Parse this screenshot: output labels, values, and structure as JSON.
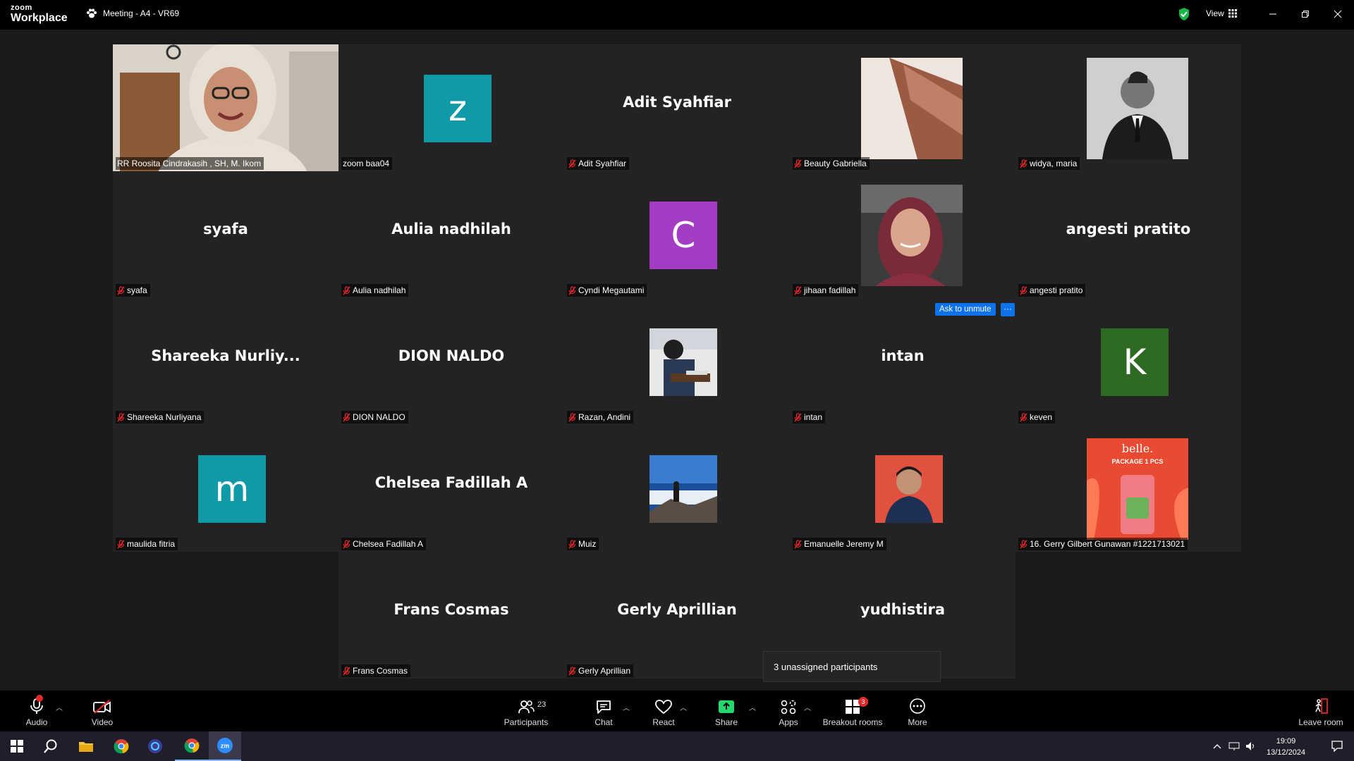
{
  "titlebar": {
    "logo_top": "zoom",
    "logo_bottom": "Workplace",
    "meeting_title": "Meeting - A4 - VR69",
    "view_label": "View",
    "icons": [
      "shield-check-icon",
      "grid-icon",
      "minimize-icon",
      "maximize-icon",
      "close-icon"
    ]
  },
  "ask_to_unmute": {
    "label": "Ask to unmute",
    "more": "···"
  },
  "unassigned": {
    "text": "3 unassigned participants"
  },
  "participants": [
    {
      "name": "RR Roosita Cindrakasih , SH, M. Ikom",
      "muted": false,
      "mode": "photo",
      "active": true
    },
    {
      "name": "zoom baa04",
      "muted": false,
      "mode": "avatar",
      "initial": "z",
      "color": "#0e9aa7"
    },
    {
      "name": "Adit Syahfiar",
      "muted": true,
      "mode": "name",
      "display": "Adit Syahfiar"
    },
    {
      "name": "Beauty Gabriella",
      "muted": true,
      "mode": "photo"
    },
    {
      "name": "widya, maria",
      "muted": true,
      "mode": "photo"
    },
    {
      "name": "syafa",
      "muted": true,
      "mode": "name",
      "display": "syafa"
    },
    {
      "name": "Aulia nadhilah",
      "muted": true,
      "mode": "name",
      "display": "Aulia nadhilah"
    },
    {
      "name": "Cyndi Megautami",
      "muted": true,
      "mode": "avatar",
      "initial": "C",
      "color": "#a43cc4"
    },
    {
      "name": "jihaan fadillah",
      "muted": true,
      "mode": "photo"
    },
    {
      "name": "angesti pratito",
      "muted": true,
      "mode": "name",
      "display": "angesti pratito"
    },
    {
      "name": "Shareeka Nurliyana",
      "muted": true,
      "mode": "name",
      "display": "Shareeka  Nurliy..."
    },
    {
      "name": "DION NALDO",
      "muted": true,
      "mode": "name",
      "display": "DION NALDO"
    },
    {
      "name": "Razan, Andini",
      "muted": true,
      "mode": "photo"
    },
    {
      "name": "intan",
      "muted": true,
      "mode": "name",
      "display": "intan"
    },
    {
      "name": "keven",
      "muted": true,
      "mode": "avatar",
      "initial": "K",
      "color": "#2e6b22"
    },
    {
      "name": "maulida fitria",
      "muted": true,
      "mode": "avatar",
      "initial": "m",
      "color": "#0e9aa7"
    },
    {
      "name": "Chelsea Fadillah A",
      "muted": true,
      "mode": "name",
      "display": "Chelsea Fadillah A"
    },
    {
      "name": "Muiz",
      "muted": true,
      "mode": "photo"
    },
    {
      "name": "Emanuelle Jeremy M",
      "muted": true,
      "mode": "photo"
    },
    {
      "name": "16. Gerry Gilbert Gunawan #1221713021",
      "muted": true,
      "mode": "photo",
      "photo_text": "belle.",
      "photo_sub": "PACKAGE 1 PCS"
    },
    {
      "name": "Frans Cosmas",
      "muted": true,
      "mode": "name",
      "display": "Frans Cosmas"
    },
    {
      "name": "Gerly Aprillian",
      "muted": true,
      "mode": "name",
      "display": "Gerly Aprillian"
    },
    {
      "name": "yudhistira",
      "muted": true,
      "mode": "name",
      "display": "yudhistira",
      "hide_label": true
    }
  ],
  "toolbar": {
    "audio": "Audio",
    "video": "Video",
    "participants": "Participants",
    "participants_count": "23",
    "chat": "Chat",
    "react": "React",
    "share": "Share",
    "apps": "Apps",
    "breakout": "Breakout rooms",
    "breakout_badge": "3",
    "more": "More",
    "leave": "Leave room"
  },
  "taskbar": {
    "time": "19:09",
    "date": "13/12/2024"
  },
  "colors": {
    "active_border": "#22d68a",
    "share_green": "#23d96e",
    "accent_blue": "#0e72ed",
    "muted_red": "#e02828"
  }
}
